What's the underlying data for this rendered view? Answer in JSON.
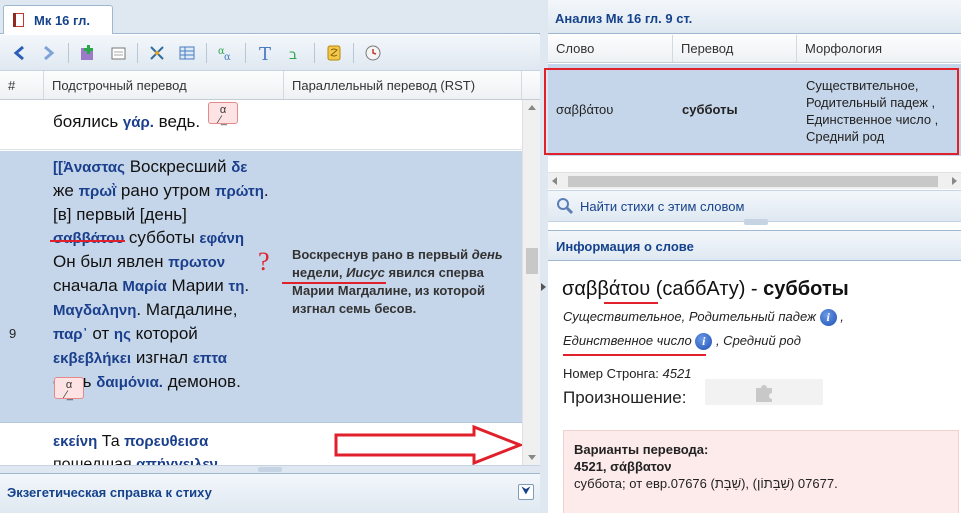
{
  "tab": {
    "title": "Мк 16 гл."
  },
  "grid": {
    "columns": [
      "#",
      "Подстрочный перевод",
      "Параллельный перевод (RST)"
    ],
    "row1": {
      "text": "боялись",
      "greek": "γάρ.",
      "text2": "ведь."
    },
    "row9": {
      "num": "9",
      "l1": {
        "gr1": "[[Ἀναστας",
        "ru1": "Воскресший",
        "gr2": "δε"
      },
      "l2": {
        "ru1": "же",
        "gr1": "πρωῒ",
        "ru2": "рано утром",
        "gr2": "πρώτη"
      },
      "l3": {
        "ru1": "[в] первый [день]"
      },
      "l4": {
        "gr1": "σαββάτου",
        "ru1": "субботы",
        "gr2": "εφάνη"
      },
      "l5": {
        "ru1": "Он был явлен",
        "gr1": "πρωτον"
      },
      "l6": {
        "ru1": "сначала",
        "gr1": "Μαρία",
        "ru2": "Марии",
        "gr2": "τη"
      },
      "l7": {
        "gr1": "Μαγδαληνη",
        "ru1": "Магдалине,"
      },
      "l8": {
        "gr1": "παρ᾽",
        "ru1": "от",
        "gr2": "ης",
        "ru2": "которой"
      },
      "l9": {
        "gr1": "εκβεβλήκει",
        "ru1": "изгнал",
        "gr2": "επτα"
      },
      "l10": {
        "ru1": "семь",
        "gr1": "δαιμόνια.",
        "ru2": "демонов."
      },
      "parallel": {
        "p1": "Воскреснув рано в первый",
        "p2i": "день",
        "p3": "недели,",
        "p4i": "Иисус",
        "p5": "явился сперва Марии Магдалине, из которой изгнал семь бесов."
      },
      "question": "?"
    },
    "row10": {
      "gr1": "εκείνη",
      "ru1": "Та",
      "gr2": "πορευθεισα",
      "ru2": "пошедшая",
      "gr3": "απήγγειλεν"
    }
  },
  "exegesis": {
    "title": "Экзегетическая справка к стиху"
  },
  "analysis": {
    "title": "Анализ Мк 16 гл. 9 ст.",
    "columns": [
      "Слово",
      "Перевод",
      "Морфология"
    ],
    "row": {
      "word": "σαββάτου",
      "translation": "субботы",
      "morph": "Существительное, Родительный падеж , Единственное число , Средний род"
    }
  },
  "find": {
    "label": "Найти стихи с этим словом"
  },
  "info": {
    "title": "Информация о слове",
    "word": "σαββάτου",
    "translit": "(саббАту) -",
    "translation": "субботы",
    "morph1": "Существительное, Родительный падеж",
    "morph2": "Единственное число",
    "morph3": ", Средний род",
    "strong_label": "Номер Стронга:",
    "strong_num": "4521",
    "pron_label": "Произношение:",
    "variants_title": "Варианты перевода:",
    "variants_head": "4521, σάββατον",
    "variants_body": "суббота; от евр.07676 (שַׁבָּת), 07677 (שַׁבָּתוֹן)."
  }
}
